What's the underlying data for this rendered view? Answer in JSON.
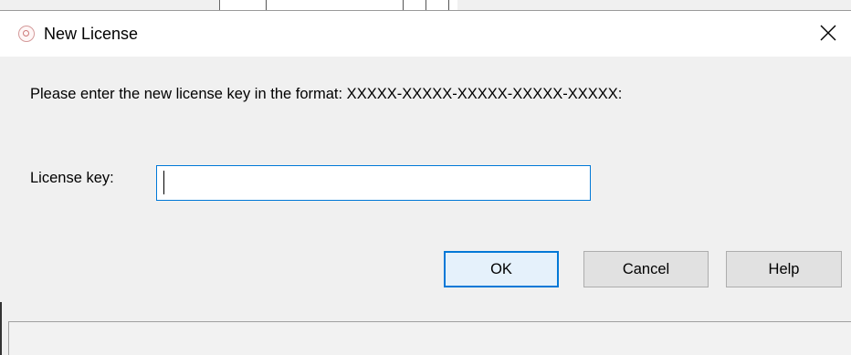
{
  "dialog": {
    "title": "New License",
    "icon": "license-app-icon",
    "close_icon": "close-icon"
  },
  "main": {
    "instruction": "Please enter the new license key in the format: XXXXX-XXXXX-XXXXX-XXXXX-XXXXX:",
    "key_label": "License key:",
    "key_value": "",
    "key_placeholder": ""
  },
  "buttons": {
    "ok": "OK",
    "cancel": "Cancel",
    "help": "Help"
  },
  "colors": {
    "accent": "#0078d7",
    "titlebar": "#ffffff",
    "dialog_bg": "#f0f0f0"
  }
}
